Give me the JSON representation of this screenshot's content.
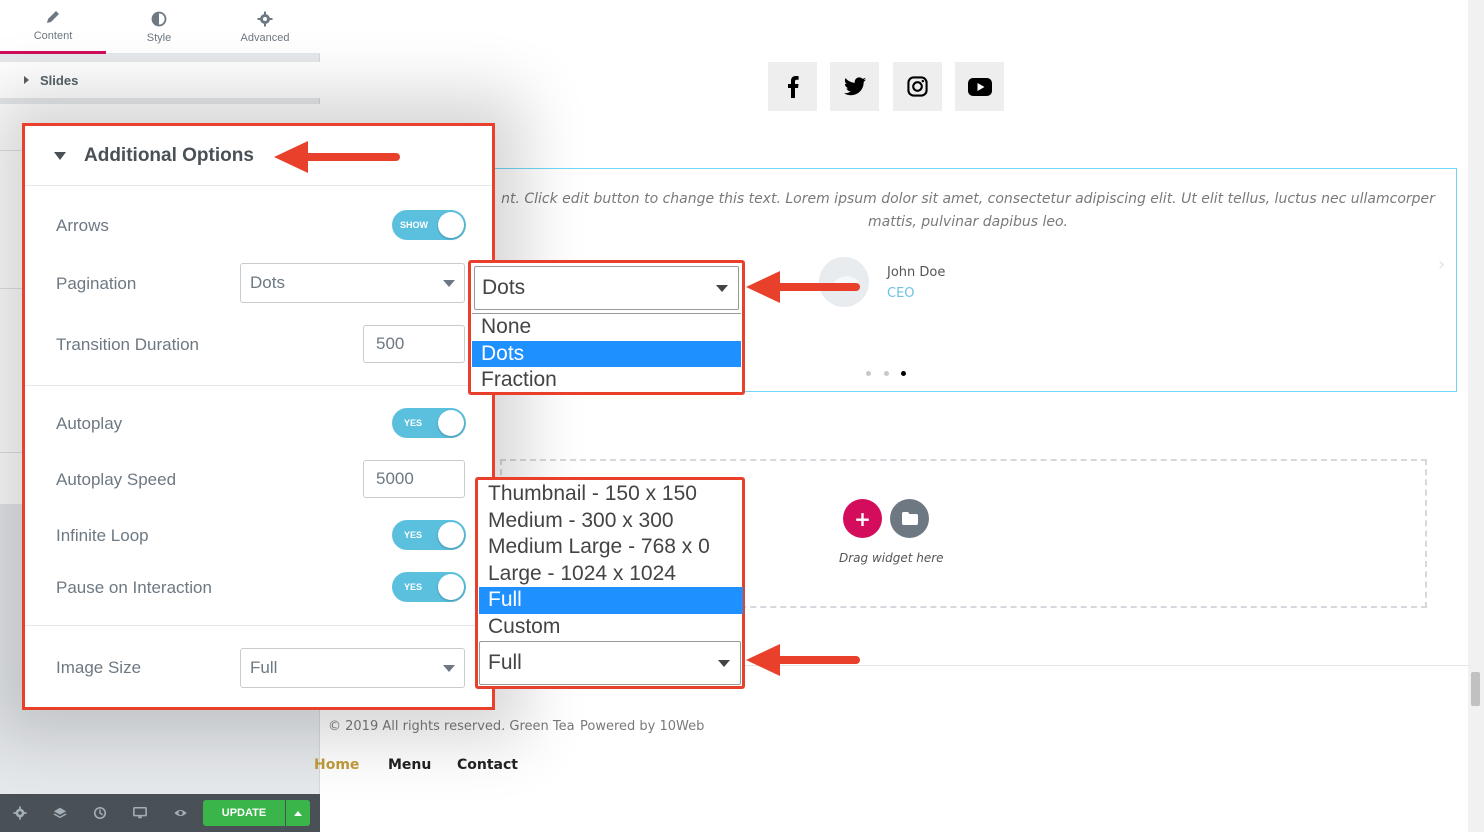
{
  "panel": {
    "tabs": [
      {
        "label": "Content",
        "icon": "pencil-icon",
        "active": true
      },
      {
        "label": "Style",
        "icon": "contrast-icon",
        "active": false
      },
      {
        "label": "Advanced",
        "icon": "gear-icon",
        "active": false
      }
    ],
    "slides_section": "Slides",
    "update_label": "UPDATE"
  },
  "options": {
    "title": "Additional Options",
    "arrows": {
      "label": "Arrows",
      "toggle": "SHOW"
    },
    "pagination": {
      "label": "Pagination",
      "value": "Dots"
    },
    "transition": {
      "label": "Transition Duration",
      "value": "500"
    },
    "autoplay": {
      "label": "Autoplay",
      "toggle": "YES"
    },
    "autoplay_speed": {
      "label": "Autoplay Speed",
      "value": "5000"
    },
    "infinite_loop": {
      "label": "Infinite Loop",
      "toggle": "YES"
    },
    "pause": {
      "label": "Pause on Interaction",
      "toggle": "YES"
    },
    "image_size": {
      "label": "Image Size",
      "value": "Full"
    }
  },
  "pagination_dropdown": {
    "selected": "Dots",
    "options": [
      "None",
      "Dots",
      "Fraction"
    ],
    "highlighted_index": 1
  },
  "image_size_dropdown": {
    "selected": "Full",
    "options": [
      "Thumbnail - 150 x 150",
      "Medium - 300 x 300",
      "Medium Large - 768 x 0",
      "Large - 1024 x 1024",
      "Full",
      "Custom"
    ],
    "highlighted_index": 4
  },
  "preview": {
    "social_icons": [
      "facebook-icon",
      "twitter-icon",
      "instagram-icon",
      "youtube-icon"
    ],
    "testimonial_text": "nt. Click edit button to change this text. Lorem ipsum dolor sit amet, consectetur adipiscing elit. Ut elit tellus, luctus nec ullamcorper mattis, pulvinar dapibus leo.",
    "author_name": "John Doe",
    "author_role": "CEO",
    "pagination_dots": 3,
    "active_dot": 3,
    "drag_text": "Drag widget here",
    "copyright": "© 2019 All rights reserved. Green Tea",
    "powered_by": "Powered by 10Web",
    "menu": [
      "Home",
      "Menu",
      "Contact"
    ]
  },
  "colors": {
    "accent": "#d30c5c",
    "callout": "#e8402a",
    "toggle_on": "#5bc0de",
    "update": "#39b54a",
    "selection": "#1e90ff",
    "link_active": "#c29b3c"
  }
}
